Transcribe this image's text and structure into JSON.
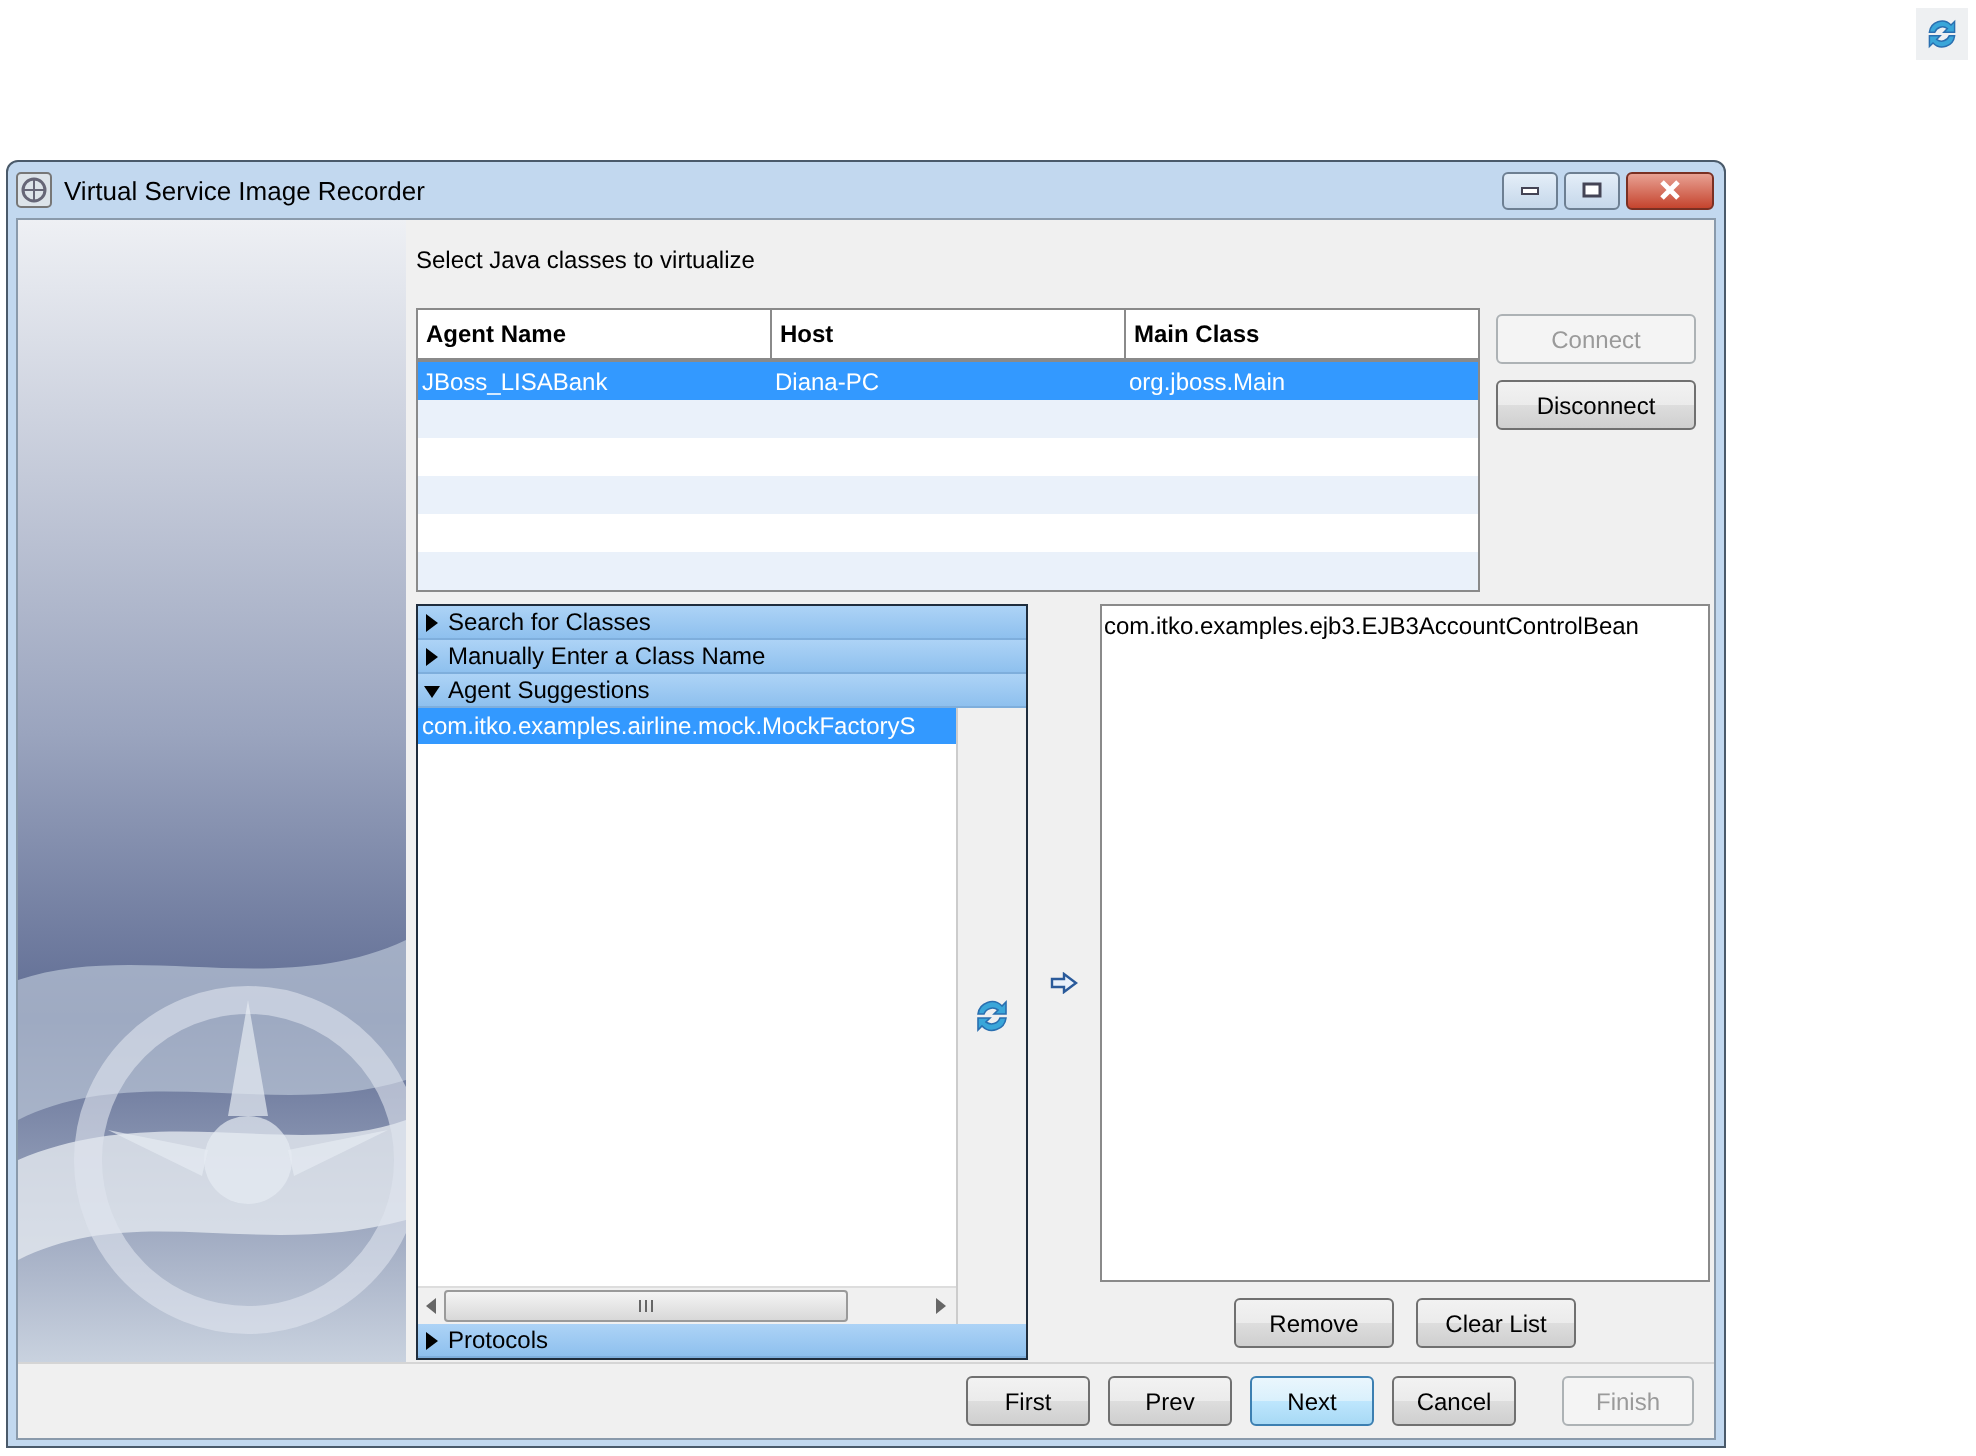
{
  "window": {
    "title": "Virtual Service Image Recorder"
  },
  "instruction": "Select Java classes to virtualize",
  "agents_table": {
    "columns": [
      "Agent Name",
      "Host",
      "Main Class"
    ],
    "rows": [
      {
        "cells": [
          "JBoss_LISABank",
          "Diana-PC",
          "org.jboss.Main"
        ],
        "selected": true
      }
    ]
  },
  "agent_buttons": [
    {
      "label": "Connect",
      "disabled": true
    },
    {
      "label": "Disconnect",
      "disabled": false
    }
  ],
  "sections": [
    {
      "label": "Search for Classes",
      "expanded": false
    },
    {
      "label": "Manually Enter a Class Name",
      "expanded": false
    },
    {
      "label": "Agent Suggestions",
      "expanded": true,
      "items": [
        {
          "text": "com.itko.examples.airline.mock.MockFactoryS",
          "selected": true
        }
      ]
    },
    {
      "label": "Protocols",
      "expanded": false
    }
  ],
  "chosen_classes": [
    "com.itko.examples.ejb3.EJB3AccountControlBean"
  ],
  "list_buttons": [
    {
      "label": "Remove",
      "disabled": false
    },
    {
      "label": "Clear List",
      "disabled": false
    }
  ],
  "nav_buttons": [
    {
      "label": "First",
      "disabled": false,
      "focused": false
    },
    {
      "label": "Prev",
      "disabled": false,
      "focused": false
    },
    {
      "label": "Next",
      "disabled": false,
      "focused": true
    },
    {
      "label": "Cancel",
      "disabled": false,
      "focused": false
    },
    {
      "label": "Finish",
      "disabled": true,
      "focused": false
    }
  ]
}
